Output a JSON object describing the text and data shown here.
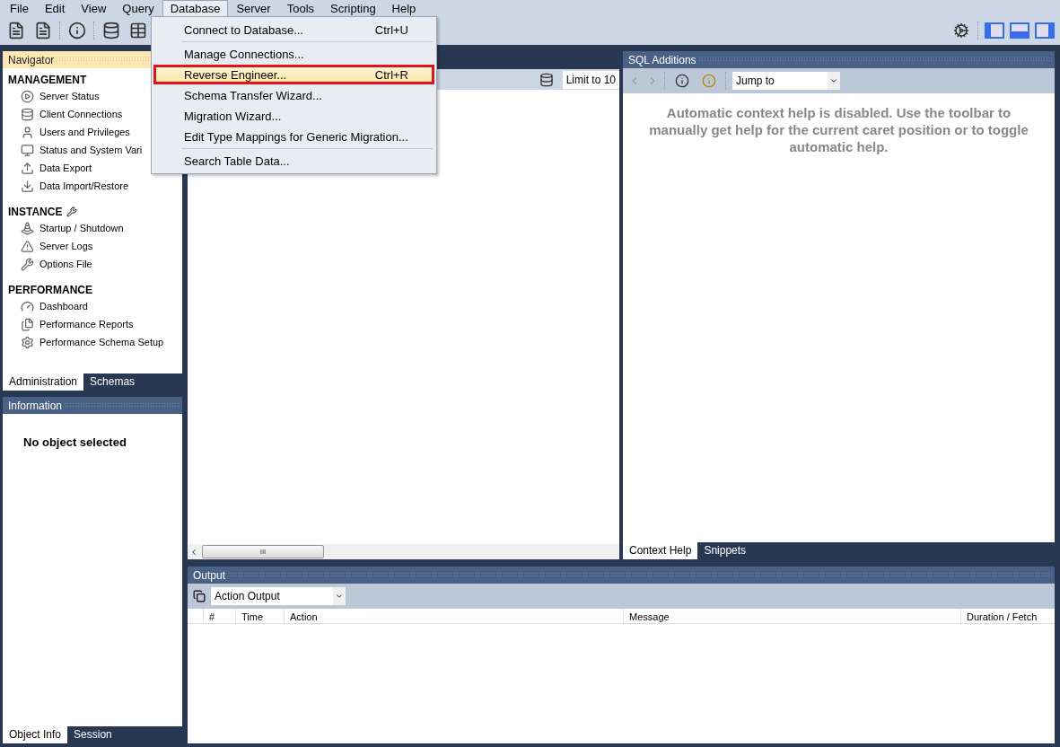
{
  "menubar": [
    {
      "label": "File",
      "selected": false
    },
    {
      "label": "Edit",
      "selected": false
    },
    {
      "label": "View",
      "selected": false
    },
    {
      "label": "Query",
      "selected": false
    },
    {
      "label": "Database",
      "selected": true
    },
    {
      "label": "Server",
      "selected": false
    },
    {
      "label": "Tools",
      "selected": false
    },
    {
      "label": "Scripting",
      "selected": false
    },
    {
      "label": "Help",
      "selected": false
    }
  ],
  "dropdown": {
    "sections": [
      [
        {
          "label": "Connect to Database...",
          "shortcut": "Ctrl+U",
          "selected": false,
          "annotated": false
        }
      ],
      [
        {
          "label": "Manage Connections...",
          "selected": false,
          "annotated": false
        },
        {
          "label": "Reverse Engineer...",
          "shortcut": "Ctrl+R",
          "selected": true,
          "annotated": true
        },
        {
          "label": "Schema Transfer Wizard...",
          "selected": false,
          "annotated": false
        },
        {
          "label": "Migration Wizard...",
          "selected": false,
          "annotated": false
        },
        {
          "label": "Edit Type Mappings for Generic Migration...",
          "selected": false,
          "annotated": false
        }
      ],
      [
        {
          "label": "Search Table Data...",
          "selected": false,
          "annotated": false
        }
      ]
    ]
  },
  "navigator": {
    "title": "Navigator",
    "sections": [
      {
        "title": "MANAGEMENT",
        "items": [
          "Server Status",
          "Client Connections",
          "Users and Privileges",
          "Status and System Vari",
          "Data Export",
          "Data Import/Restore"
        ]
      },
      {
        "title": "INSTANCE",
        "items": [
          "Startup / Shutdown",
          "Server Logs",
          "Options File"
        ]
      },
      {
        "title": "PERFORMANCE",
        "items": [
          "Dashboard",
          "Performance Reports",
          "Performance Schema Setup"
        ]
      }
    ],
    "tabs": [
      {
        "label": "Administration",
        "selected": true
      },
      {
        "label": "Schemas",
        "selected": false
      }
    ]
  },
  "information": {
    "title": "Information",
    "message": "No object selected",
    "tabs": [
      {
        "label": "Object Info",
        "selected": true
      },
      {
        "label": "Session",
        "selected": false
      }
    ]
  },
  "editor": {
    "limit": "Limit to 10",
    "scroll_grip": "III"
  },
  "sql_additions": {
    "title": "SQL Additions",
    "jump_to": "Jump to",
    "help_text": "Automatic context help is disabled. Use the toolbar to manually get help for the current caret position or to toggle automatic help.",
    "tabs": [
      {
        "label": "Context Help",
        "selected": true
      },
      {
        "label": "Snippets",
        "selected": false
      }
    ]
  },
  "output": {
    "title": "Output",
    "selector": "Action Output",
    "columns": [
      "#",
      "Time",
      "Action",
      "Message",
      "Duration / Fetch"
    ]
  }
}
